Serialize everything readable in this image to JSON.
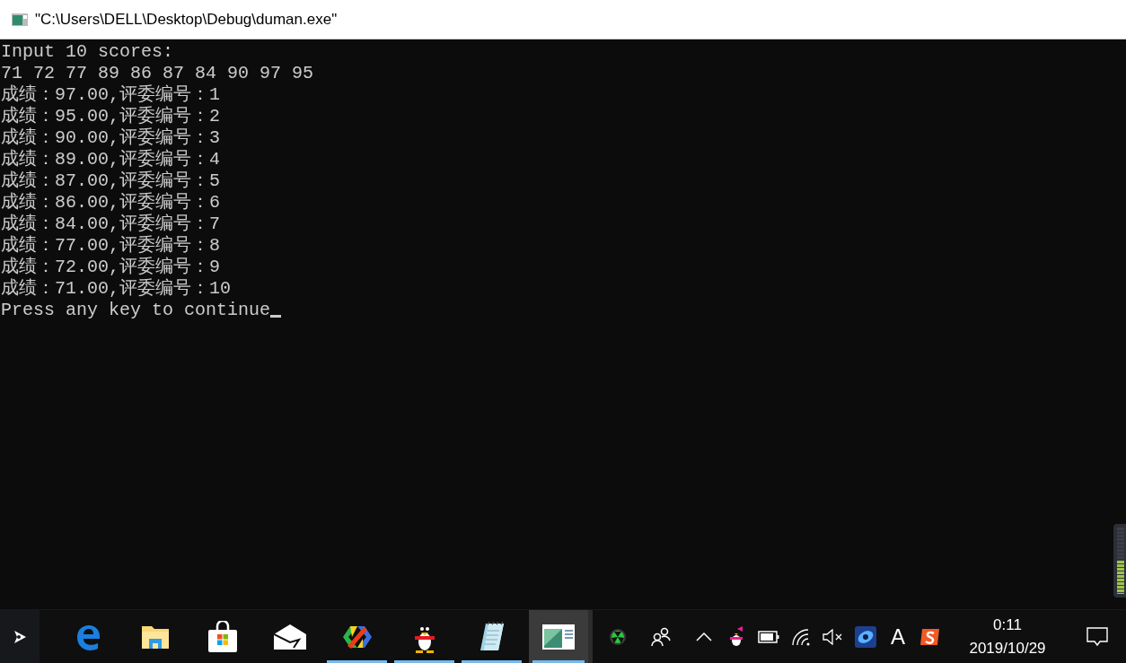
{
  "window": {
    "title": "\"C:\\Users\\DELL\\Desktop\\Debug\\duman.exe\""
  },
  "console": {
    "lines": [
      "Input 10 scores:",
      "71 72 77 89 86 87 84 90 97 95",
      "成绩：97.00,评委编号：1",
      "成绩：95.00,评委编号：2",
      "成绩：90.00,评委编号：3",
      "成绩：89.00,评委编号：4",
      "成绩：87.00,评委编号：5",
      "成绩：86.00,评委编号：6",
      "成绩：84.00,评委编号：7",
      "成绩：77.00,评委编号：8",
      "成绩：72.00,评委编号：9",
      "成绩：71.00,评委编号：10",
      "Press any key to continue"
    ],
    "cursor": true
  },
  "volume_meter": {
    "level": 0.5
  },
  "taskbar": {
    "apps": [
      {
        "kind": "edge",
        "running": false,
        "selected": false
      },
      {
        "kind": "folder",
        "running": false,
        "selected": false
      },
      {
        "kind": "store",
        "running": false,
        "selected": false
      },
      {
        "kind": "mail",
        "running": false,
        "selected": false
      },
      {
        "kind": "colorful",
        "running": true,
        "selected": false
      },
      {
        "kind": "penguin",
        "running": true,
        "selected": false
      },
      {
        "kind": "notepad",
        "running": true,
        "selected": false
      },
      {
        "kind": "console",
        "running": true,
        "selected": true
      }
    ],
    "tray": {
      "input_indicator": "A",
      "time": "0:11",
      "date": "2019/10/29"
    }
  }
}
